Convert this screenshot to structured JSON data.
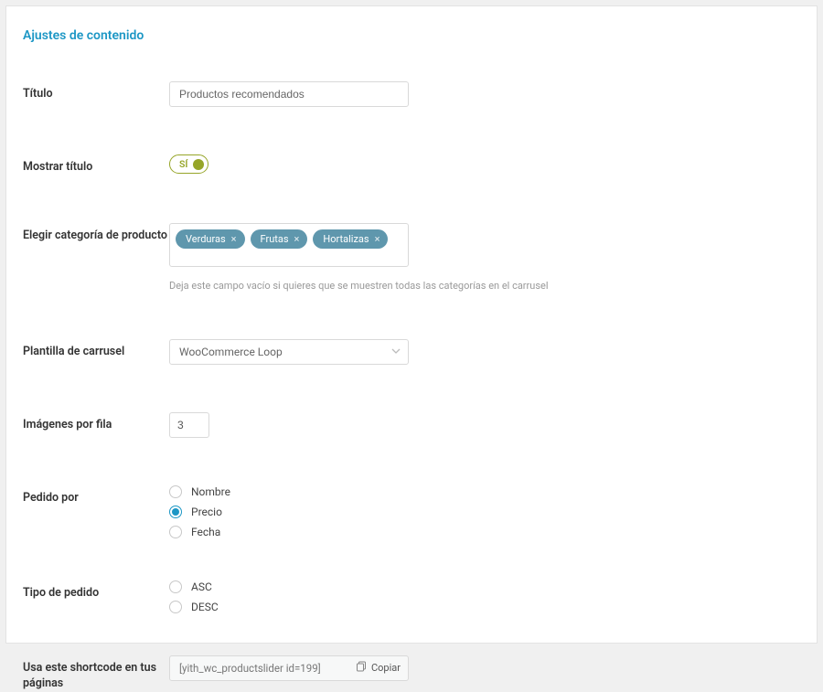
{
  "section_title": "Ajustes de contenido",
  "labels": {
    "titulo": "Título",
    "mostrar_titulo": "Mostrar título",
    "categoria": "Elegir categoría de producto",
    "plantilla": "Plantilla de carrusel",
    "imagenes_fila": "Imágenes por fila",
    "pedido_por": "Pedido por",
    "tipo_pedido": "Tipo de pedido",
    "shortcode": "Usa este shortcode en tus páginas"
  },
  "titulo": {
    "value": "Productos recomendados"
  },
  "mostrar_titulo": {
    "on": true,
    "on_label": "SÍ"
  },
  "categoria": {
    "tags": [
      "Verduras",
      "Frutas",
      "Hortalizas"
    ],
    "hint": "Deja este campo vacío si quieres que se muestren todas las categorías en el carrusel"
  },
  "plantilla": {
    "selected": "WooCommerce Loop"
  },
  "imagenes_fila": {
    "value": "3"
  },
  "pedido_por": {
    "options": [
      "Nombre",
      "Precio",
      "Fecha"
    ],
    "selected": "Precio"
  },
  "tipo_pedido": {
    "options": [
      "ASC",
      "DESC"
    ],
    "selected": ""
  },
  "shortcode": {
    "value": "[yith_wc_productslider id=199]",
    "copy_label": "Copiar"
  }
}
